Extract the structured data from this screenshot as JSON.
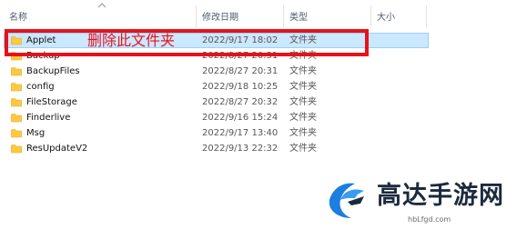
{
  "columns": {
    "name": "名称",
    "date": "修改日期",
    "type": "类型",
    "size": "大小"
  },
  "rows": [
    {
      "name": "Applet",
      "date": "2022/9/17 18:02",
      "type": "文件夹",
      "icon": "folder-icon",
      "selected": true
    },
    {
      "name": "Backup",
      "date": "2022/8/27 20:31",
      "type": "文件夹",
      "icon": "folder-icon"
    },
    {
      "name": "BackupFiles",
      "date": "2022/8/27 20:31",
      "type": "文件夹",
      "icon": "folder-icon"
    },
    {
      "name": "config",
      "date": "2022/9/18 10:25",
      "type": "文件夹",
      "icon": "folder-icon"
    },
    {
      "name": "FileStorage",
      "date": "2022/8/27 20:32",
      "type": "文件夹",
      "icon": "folder-icon"
    },
    {
      "name": "Finderlive",
      "date": "2022/9/16 15:24",
      "type": "文件夹",
      "icon": "folder-icon"
    },
    {
      "name": "Msg",
      "date": "2022/9/17 13:40",
      "type": "文件夹",
      "icon": "folder-icon"
    },
    {
      "name": "ResUpdateV2",
      "date": "2022/9/13 22:32",
      "type": "文件夹",
      "icon": "folder-icon"
    }
  ],
  "annotation": {
    "text": "删除此文件夹",
    "color": "#e8111a"
  },
  "watermark": {
    "title": "高达手游网",
    "url": "hbLfgd.com"
  },
  "colors": {
    "selection_bg": "#cce8ff",
    "selection_border": "#99d1ff",
    "folder": "#ffc83d",
    "header_text": "#4c5c6e"
  }
}
